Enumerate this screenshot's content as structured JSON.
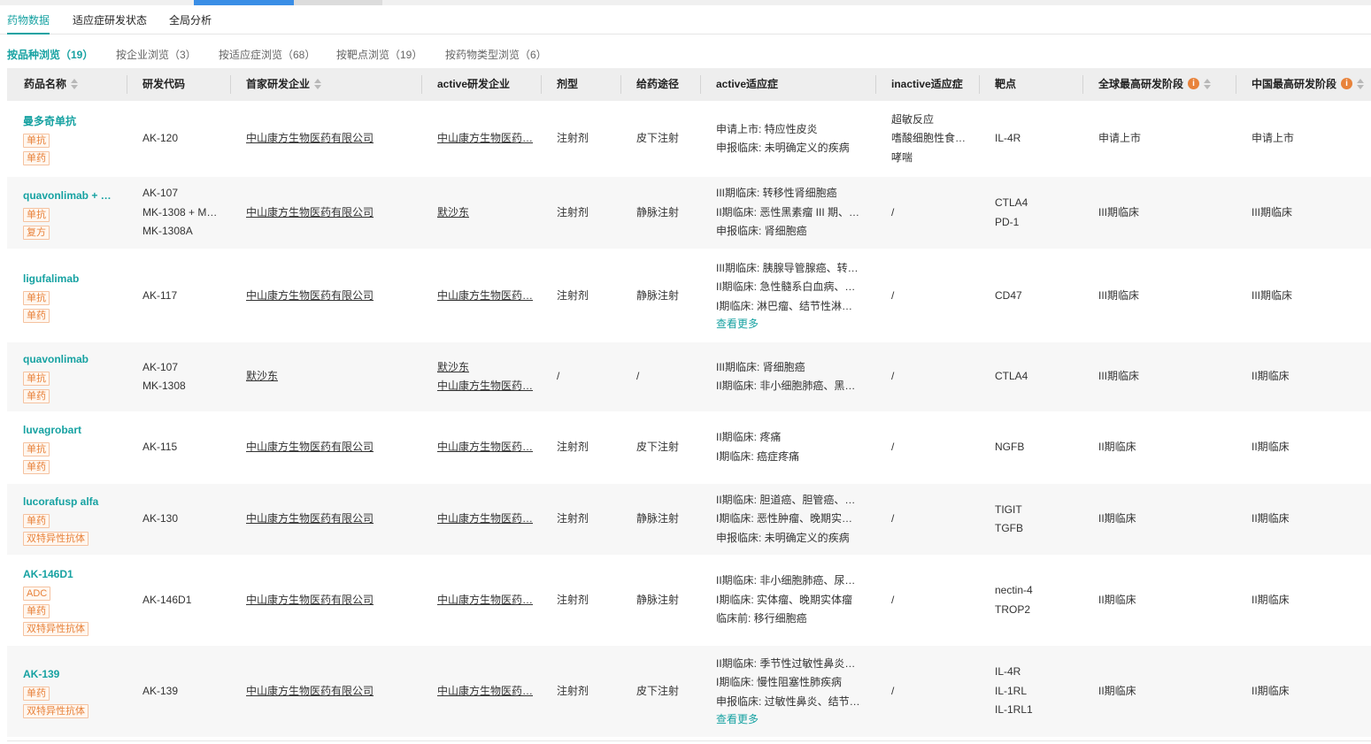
{
  "colors": {
    "accent": "#17a2a2",
    "tag": "#e8823a"
  },
  "main_tabs": [
    "药物数据",
    "适应症研发状态",
    "全局分析"
  ],
  "sub_tabs": [
    "按品种浏览（19）",
    "按企业浏览（3）",
    "按适应症浏览（68）",
    "按靶点浏览（19）",
    "按药物类型浏览（6）"
  ],
  "columns": [
    "药品名称",
    "研发代码",
    "首家研发企业",
    "active研发企业",
    "剂型",
    "给药途径",
    "active适应症",
    "inactive适应症",
    "靶点",
    "全球最高研发阶段",
    "中国最高研发阶段"
  ],
  "see_more_label": "查看更多",
  "rows": [
    {
      "name": "曼多奇单抗",
      "tags": [
        "单抗",
        "单药"
      ],
      "codes": [
        "AK-120"
      ],
      "first_company": [
        "中山康方生物医药有限公司"
      ],
      "active_company": [
        "中山康方生物医药…"
      ],
      "form": "注射剂",
      "route": "皮下注射",
      "active_ind": [
        "申请上市: 特应性皮炎",
        "申报临床: 未明确定义的疾病"
      ],
      "more": false,
      "inactive_ind": [
        "超敏反应",
        "嗜酸细胞性食…",
        "哮喘"
      ],
      "targets": [
        "IL-4R"
      ],
      "global_stage": "申请上市",
      "china_stage": "申请上市"
    },
    {
      "name": "quavonlimab + …",
      "tags": [
        "单抗",
        "复方"
      ],
      "codes": [
        "AK-107",
        "MK-1308 + MK…",
        "MK-1308A"
      ],
      "first_company": [
        "中山康方生物医药有限公司"
      ],
      "active_company": [
        "默沙东"
      ],
      "form": "注射剂",
      "route": "静脉注射",
      "active_ind": [
        "III期临床: 转移性肾细胞癌",
        "II期临床: 恶性黑素瘤 III 期、…",
        "申报临床: 肾细胞癌"
      ],
      "more": false,
      "inactive_ind": [
        "/"
      ],
      "targets": [
        "CTLA4",
        "PD-1"
      ],
      "global_stage": "III期临床",
      "china_stage": "III期临床"
    },
    {
      "name": "ligufalimab",
      "tags": [
        "单抗",
        "单药"
      ],
      "codes": [
        "AK-117"
      ],
      "first_company": [
        "中山康方生物医药有限公司"
      ],
      "active_company": [
        "中山康方生物医药…"
      ],
      "form": "注射剂",
      "route": "静脉注射",
      "active_ind": [
        "III期临床: 胰腺导管腺癌、转…",
        "II期临床: 急性髓系白血病、…",
        "I期临床: 淋巴瘤、结节性淋…"
      ],
      "more": true,
      "inactive_ind": [
        "/"
      ],
      "targets": [
        "CD47"
      ],
      "global_stage": "III期临床",
      "china_stage": "III期临床"
    },
    {
      "name": "quavonlimab",
      "tags": [
        "单抗",
        "单药"
      ],
      "codes": [
        "AK-107",
        "MK-1308"
      ],
      "first_company": [
        "默沙东"
      ],
      "active_company": [
        "默沙东",
        "中山康方生物医药…"
      ],
      "form": "/",
      "route": "/",
      "active_ind": [
        "III期临床: 肾细胞癌",
        "II期临床: 非小细胞肺癌、黑…"
      ],
      "more": false,
      "inactive_ind": [
        "/"
      ],
      "targets": [
        "CTLA4"
      ],
      "global_stage": "III期临床",
      "china_stage": "II期临床"
    },
    {
      "name": "luvagrobart",
      "tags": [
        "单抗",
        "单药"
      ],
      "codes": [
        "AK-115"
      ],
      "first_company": [
        "中山康方生物医药有限公司"
      ],
      "active_company": [
        "中山康方生物医药…"
      ],
      "form": "注射剂",
      "route": "皮下注射",
      "active_ind": [
        "II期临床: 疼痛",
        "I期临床: 癌症疼痛"
      ],
      "more": false,
      "inactive_ind": [
        "/"
      ],
      "targets": [
        "NGFB"
      ],
      "global_stage": "II期临床",
      "china_stage": "II期临床"
    },
    {
      "name": "lucorafusp alfa",
      "tags": [
        "单药",
        "双特异性抗体"
      ],
      "codes": [
        "AK-130"
      ],
      "first_company": [
        "中山康方生物医药有限公司"
      ],
      "active_company": [
        "中山康方生物医药…"
      ],
      "form": "注射剂",
      "route": "静脉注射",
      "active_ind": [
        "II期临床: 胆道癌、胆管癌、…",
        "I期临床: 恶性肿瘤、晚期实…",
        "申报临床: 未明确定义的疾病"
      ],
      "more": false,
      "inactive_ind": [
        "/"
      ],
      "targets": [
        "TIGIT",
        "TGFB"
      ],
      "global_stage": "II期临床",
      "china_stage": "II期临床"
    },
    {
      "name": "AK-146D1",
      "tags": [
        "ADC",
        "单药",
        "双特异性抗体"
      ],
      "codes": [
        "AK-146D1"
      ],
      "first_company": [
        "中山康方生物医药有限公司"
      ],
      "active_company": [
        "中山康方生物医药…"
      ],
      "form": "注射剂",
      "route": "静脉注射",
      "active_ind": [
        "II期临床: 非小细胞肺癌、尿…",
        "I期临床: 实体瘤、晚期实体瘤",
        "临床前: 移行细胞癌"
      ],
      "more": false,
      "inactive_ind": [
        "/"
      ],
      "targets": [
        "nectin-4",
        "TROP2"
      ],
      "global_stage": "II期临床",
      "china_stage": "II期临床"
    },
    {
      "name": "AK-139",
      "tags": [
        "单药",
        "双特异性抗体"
      ],
      "codes": [
        "AK-139"
      ],
      "first_company": [
        "中山康方生物医药有限公司"
      ],
      "active_company": [
        "中山康方生物医药…"
      ],
      "form": "注射剂",
      "route": "皮下注射",
      "active_ind": [
        "II期临床: 季节性过敏性鼻炎…",
        "I期临床: 慢性阻塞性肺疾病",
        "申报临床: 过敏性鼻炎、结节…"
      ],
      "more": true,
      "inactive_ind": [
        "/"
      ],
      "targets": [
        "IL-4R",
        "IL-1RL",
        "IL-1RL1"
      ],
      "global_stage": "II期临床",
      "china_stage": "II期临床"
    }
  ]
}
